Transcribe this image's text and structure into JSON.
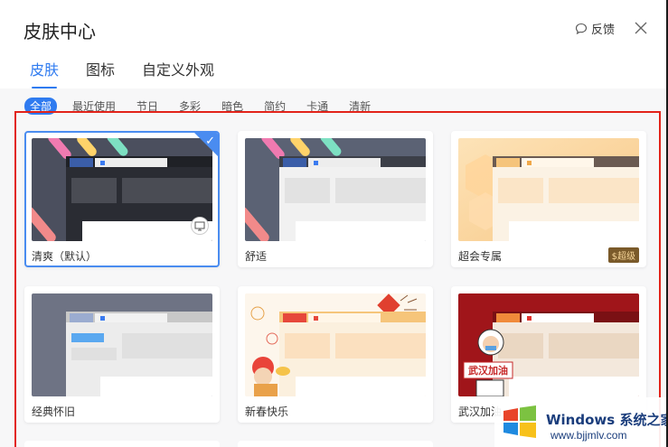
{
  "window": {
    "title": "皮肤中心",
    "feedback_label": "反馈"
  },
  "tabs": [
    {
      "label": "皮肤",
      "active": true
    },
    {
      "label": "图标",
      "active": false
    },
    {
      "label": "自定义外观",
      "active": false
    }
  ],
  "filters": [
    {
      "label": "全部",
      "active": true
    },
    {
      "label": "最近使用",
      "active": false
    },
    {
      "label": "节日",
      "active": false
    },
    {
      "label": "多彩",
      "active": false
    },
    {
      "label": "暗色",
      "active": false
    },
    {
      "label": "简约",
      "active": false
    },
    {
      "label": "卡通",
      "active": false
    },
    {
      "label": "清新",
      "active": false
    }
  ],
  "skins": [
    {
      "label": "清爽（默认）",
      "selected": true,
      "badge": ""
    },
    {
      "label": "舒适",
      "selected": false,
      "badge": ""
    },
    {
      "label": "超会专属",
      "selected": false,
      "badge": "$超级"
    },
    {
      "label": "经典怀旧",
      "selected": false,
      "badge": ""
    },
    {
      "label": "新春快乐",
      "selected": false,
      "badge": ""
    },
    {
      "label": "武汉加油",
      "selected": false,
      "badge": ""
    }
  ],
  "thumb_text": {
    "wuhan": "武汉加油"
  },
  "watermark": {
    "brand": "Windows",
    "brand_zh": "系统之家",
    "url": "www.bjjmlv.com"
  },
  "colors": {
    "accent": "#2f7bf0",
    "annotation_frame": "#e2231a"
  }
}
